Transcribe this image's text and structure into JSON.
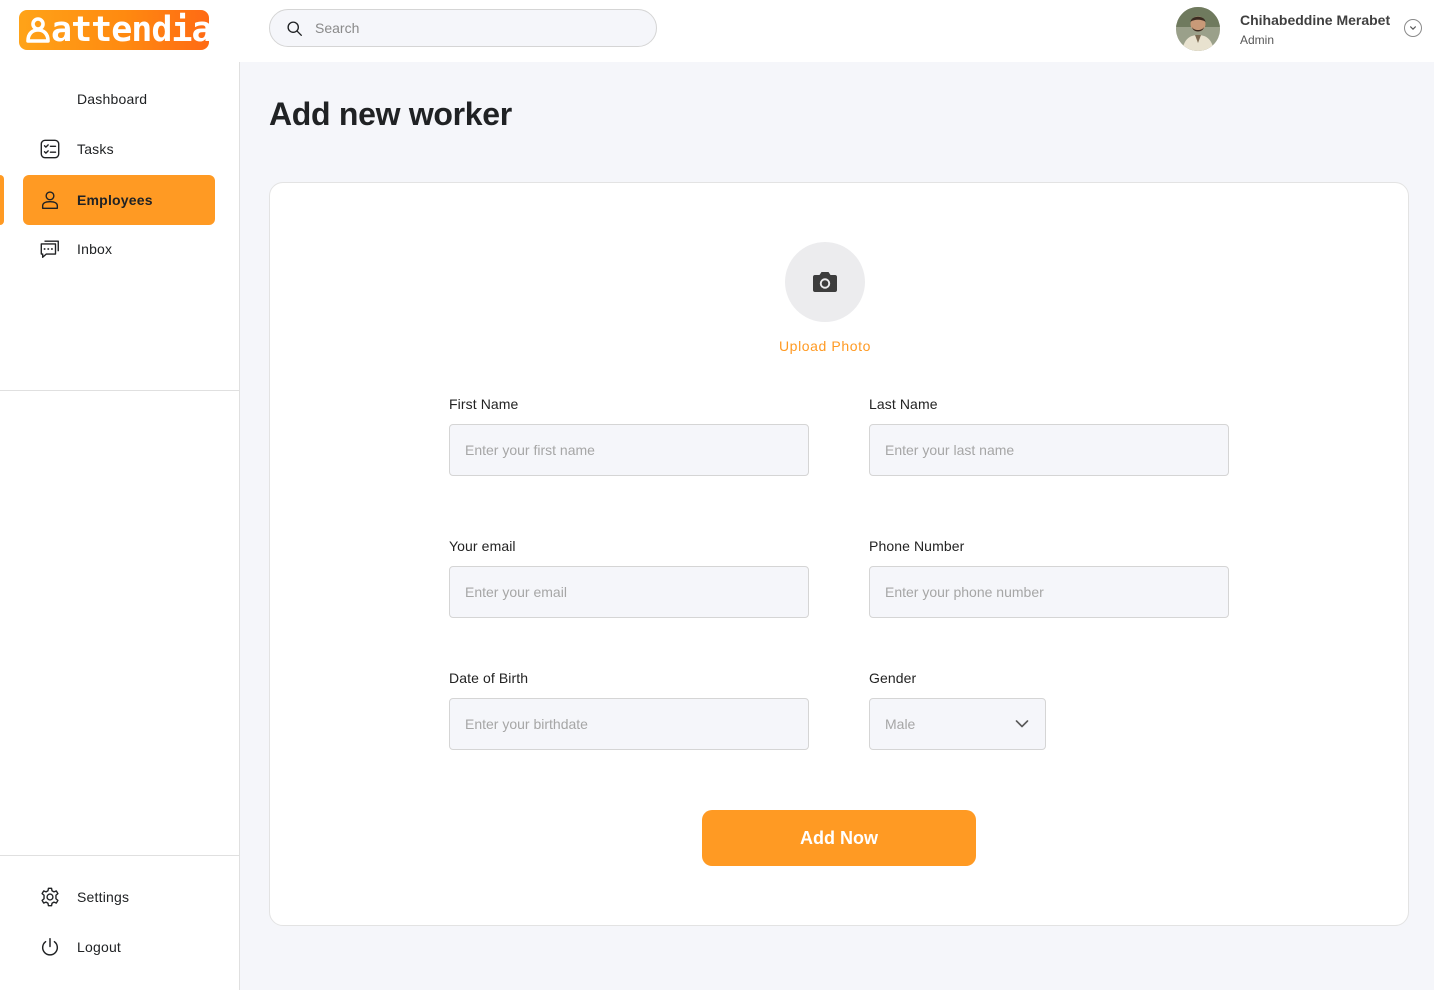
{
  "brand": {
    "name": "attendia",
    "color": "#ff9a23"
  },
  "search": {
    "placeholder": "Search",
    "icon": "search-icon"
  },
  "user": {
    "name": "Chihabeddine Merabet",
    "role": "Admin"
  },
  "sidebar": {
    "items": [
      {
        "label": "Dashboard",
        "icon": "dashboard-icon",
        "active": false
      },
      {
        "label": "Tasks",
        "icon": "task-list-icon",
        "active": false
      },
      {
        "label": "Employees",
        "icon": "user-icon",
        "active": true
      },
      {
        "label": "Inbox",
        "icon": "chat-icon",
        "active": false
      }
    ],
    "bottom": [
      {
        "label": "Settings",
        "icon": "gear-icon"
      },
      {
        "label": "Logout",
        "icon": "power-icon"
      }
    ]
  },
  "page": {
    "title": "Add new worker"
  },
  "form": {
    "upload_label": "Upload Photo",
    "first_name": {
      "label": "First Name",
      "placeholder": "Enter your first name",
      "value": ""
    },
    "last_name": {
      "label": "Last Name",
      "placeholder": "Enter your last name",
      "value": ""
    },
    "email": {
      "label": "Your email",
      "placeholder": "Enter your email",
      "value": ""
    },
    "phone": {
      "label": "Phone Number",
      "placeholder": "Enter your phone number",
      "value": ""
    },
    "birthdate": {
      "label": "Date of Birth",
      "placeholder": "Enter your birthdate",
      "value": ""
    },
    "gender": {
      "label": "Gender",
      "selected": "Male"
    },
    "submit_label": "Add Now"
  }
}
